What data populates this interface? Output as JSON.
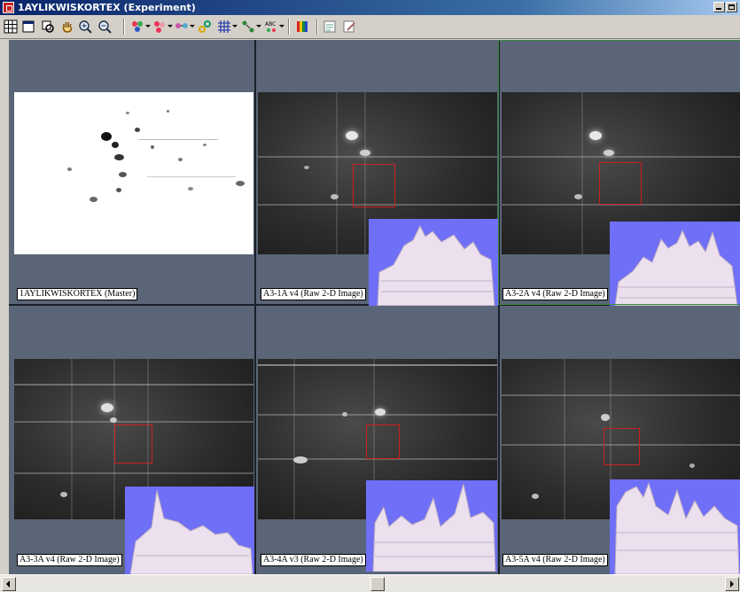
{
  "window": {
    "title": "1AYLIKWISKORTEX (Experiment)"
  },
  "toolbar": {
    "buttons": [
      "layout-grid-icon",
      "window-icon",
      "fit-view-icon",
      "hand-pan-icon",
      "zoom-in-icon",
      "zoom-out-icon",
      "spot-detect-icon",
      "spot-edit-icon",
      "spot-match-icon",
      "spot-link-icon",
      "grid-overlay-icon",
      "crop-tool-icon",
      "label-abc-icon",
      "color-bars-icon",
      "report-icon",
      "edit-notes-icon"
    ]
  },
  "panels": [
    {
      "caption": "1AYLIKWISKORTEX (Master)",
      "type": "master"
    },
    {
      "caption": "A3-1A v4 (Raw 2-D Image)",
      "type": "raw"
    },
    {
      "caption": "A3-2A v4 (Raw 2-D Image)",
      "type": "raw",
      "selected": true
    },
    {
      "caption": "A3-3A v4 (Raw 2-D Image)",
      "type": "raw"
    },
    {
      "caption": "A3-4A v3 (Raw 2-D Image)",
      "type": "raw"
    },
    {
      "caption": "A3-5A v4 (Raw 2-D Image)",
      "type": "raw"
    }
  ],
  "colors": {
    "workspace": "#5a6577",
    "roi": "#cc2020",
    "surface_bg": "#6f6ff7",
    "selected_border": "#3c8a3c"
  }
}
